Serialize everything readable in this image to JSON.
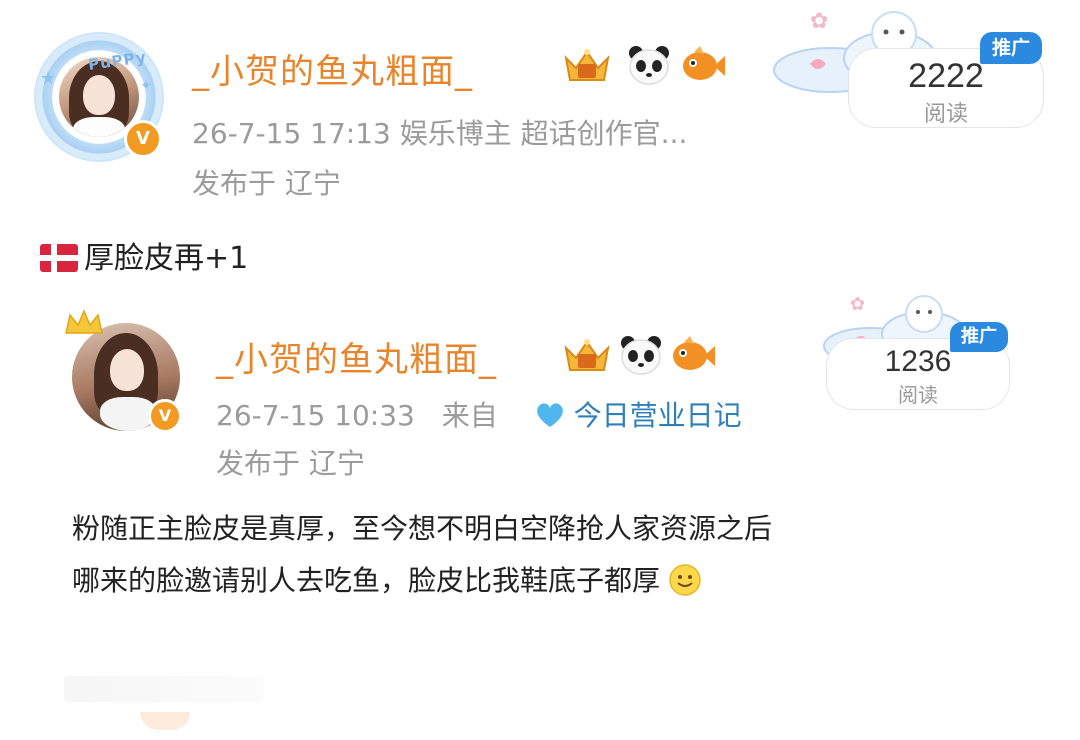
{
  "post": {
    "author": "_小贺的鱼丸粗面_",
    "meta_line": "26-7-15 17:13  娱乐博主 超话创作官...",
    "location": "发布于 辽宁",
    "read_count": "2222",
    "read_label": "阅读",
    "promo_tag": "推广",
    "avatar_ring_text": "PuPPy",
    "body": "厚脸皮再+1",
    "flag_icon": "denmark-flag-icon"
  },
  "repost": {
    "author": "_小贺的鱼丸粗面_",
    "time": "26-7-15 10:33",
    "from_label": "来自",
    "source_name": "今日营业日记",
    "location": "发布于 辽宁",
    "read_count": "1236",
    "read_label": "阅读",
    "promo_tag": "推广",
    "body_line1": "粉随正主脸皮是真厚，至今想不明白空降抢人家资源之后",
    "body_line2": "哪来的脸邀请别人去吃鱼，脸皮比我鞋底子都厚",
    "trailing_icon": "smile-emoji-icon"
  },
  "icons": [
    "crown-badge-icon",
    "panda-icon",
    "goldfish-icon",
    "verified-v-icon",
    "blue-heart-icon"
  ],
  "colors": {
    "username": "#e8842a",
    "meta": "#9b9b9b",
    "link": "#2f7fb8",
    "promo": "#2b8ae0",
    "verified": "#f39a23"
  }
}
